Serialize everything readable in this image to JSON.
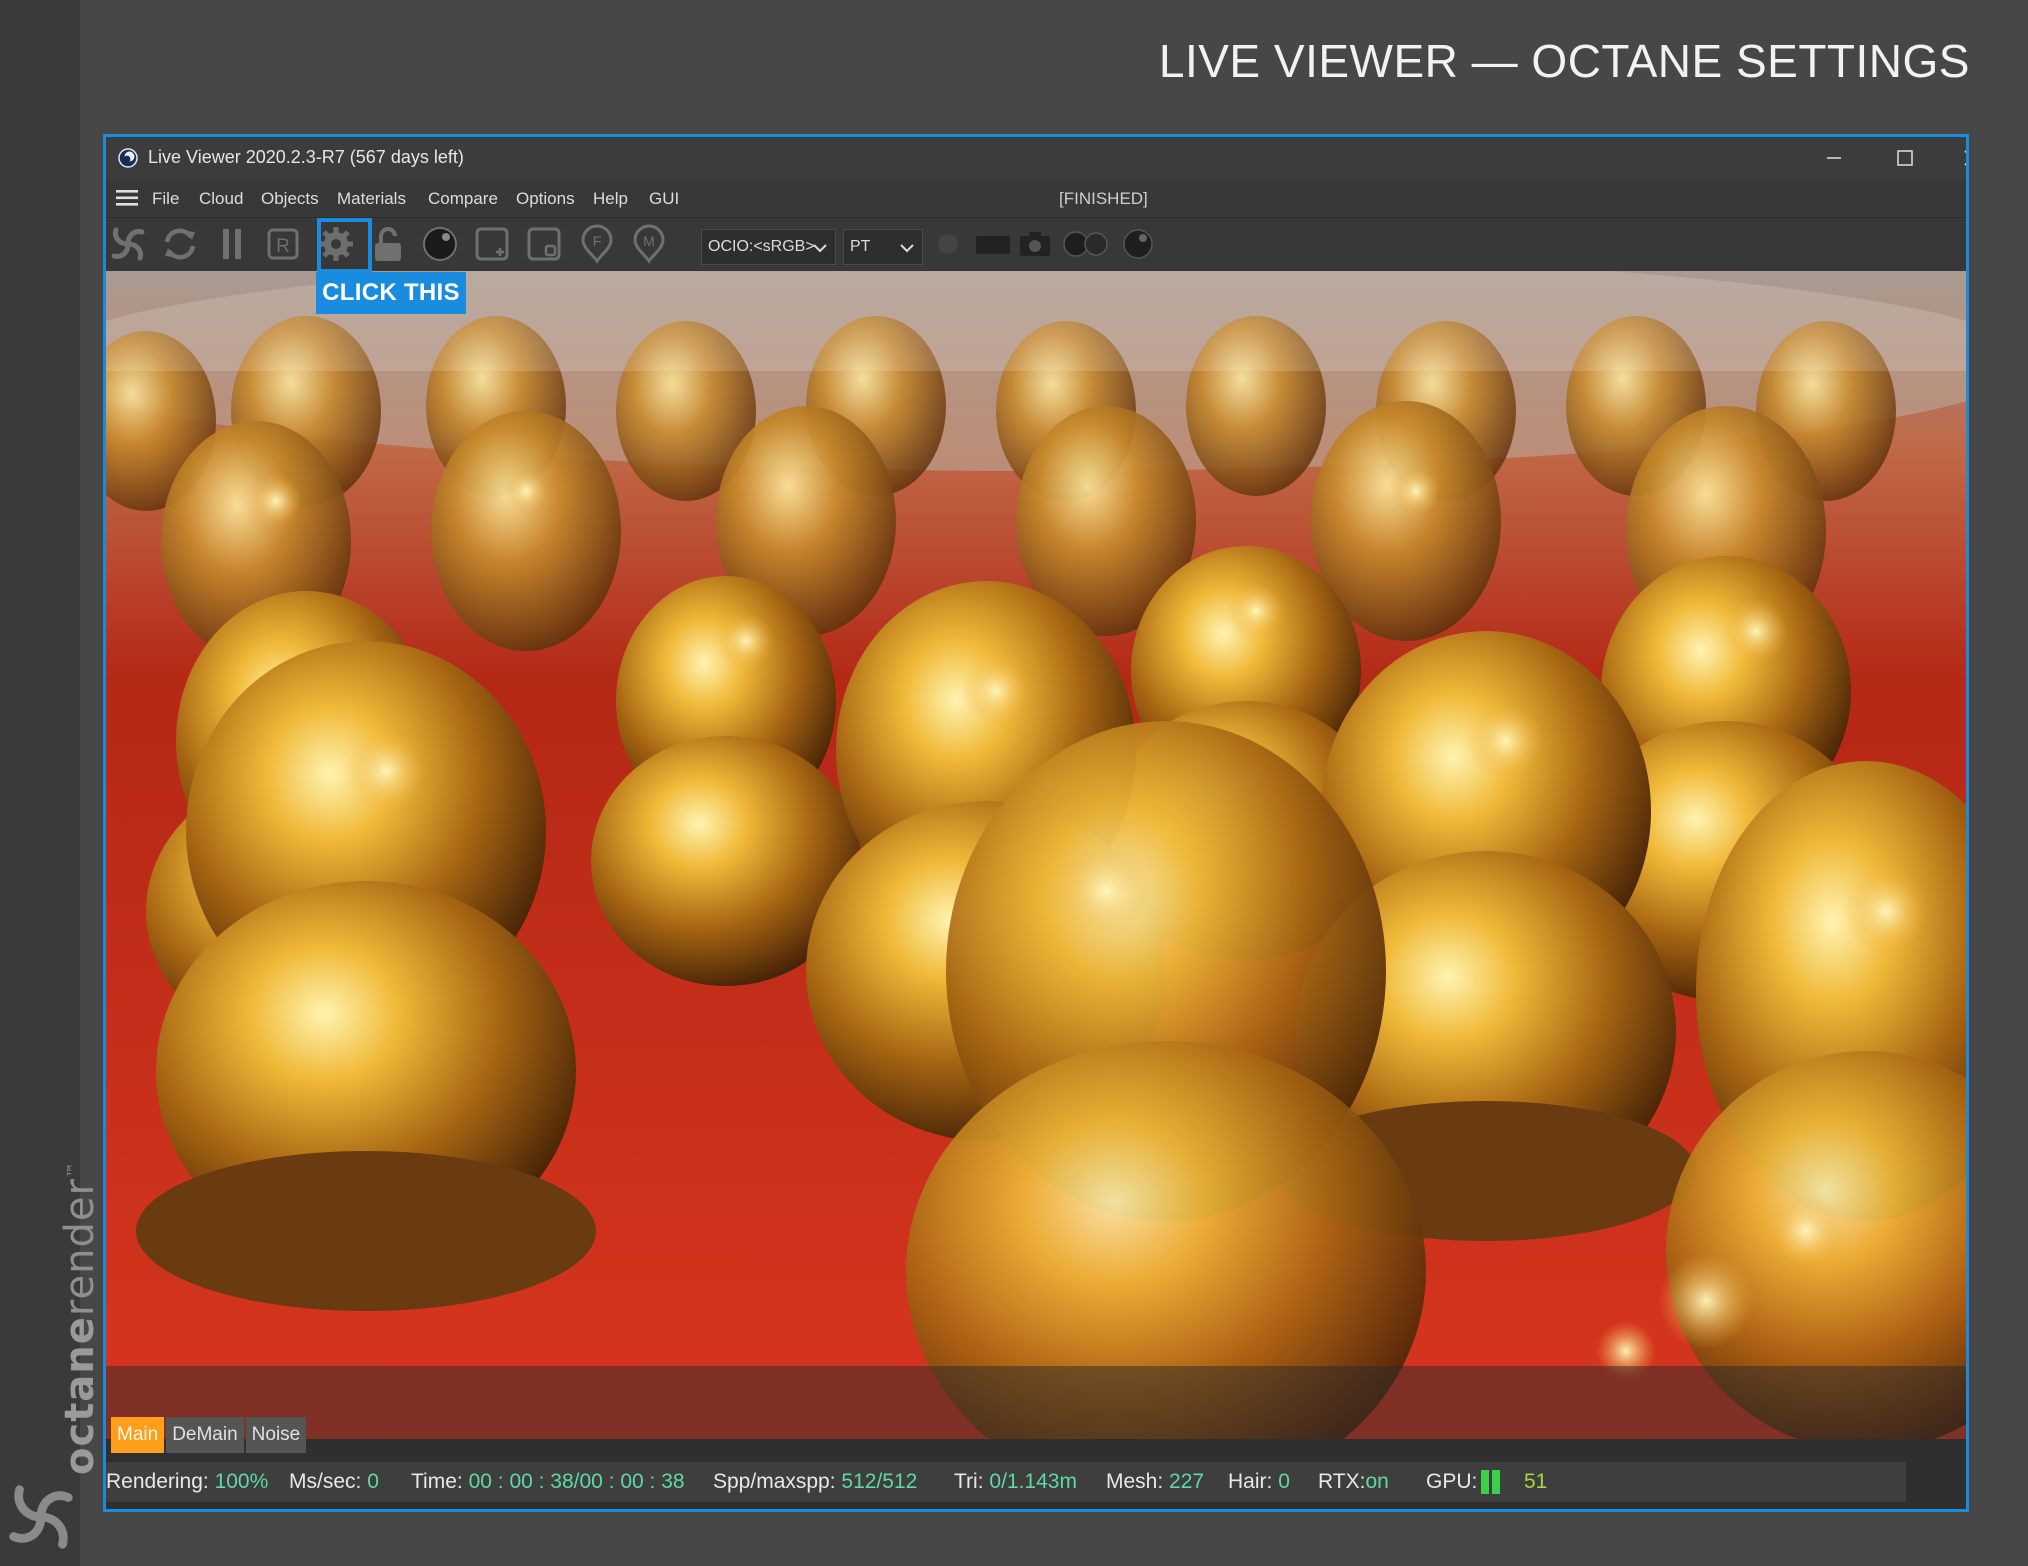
{
  "page": {
    "title": "LIVE VIEWER — OCTANE SETTINGS"
  },
  "brand": {
    "wordmark_bold": "octane",
    "wordmark_light": "render",
    "trademark": "™"
  },
  "window": {
    "title": "Live Viewer 2020.2.3-R7 (567 days left)"
  },
  "menu": {
    "items": [
      "File",
      "Cloud",
      "Objects",
      "Materials",
      "Compare",
      "Options",
      "Help",
      "GUI"
    ],
    "render_status": "[FINISHED]"
  },
  "toolbar": {
    "icons": [
      "octane-send-scene-icon",
      "restart-render-icon",
      "pause-render-icon",
      "render-region-icon",
      "settings-gear-icon",
      "lock-icon",
      "material-preview-icon",
      "add-region-icon",
      "resize-region-icon",
      "focus-picker-icon",
      "material-picker-icon"
    ],
    "color_space_select": "OCIO:<sRGB>",
    "kernel_select": "PT",
    "callout": "CLICK THIS"
  },
  "render_passes": {
    "tabs": [
      "Main",
      "DeMain",
      "Noise"
    ],
    "active": "Main"
  },
  "status": {
    "rendering_label": "Rendering:",
    "rendering_value": "100%",
    "ms_label": "Ms/sec:",
    "ms_value": "0",
    "time_label": "Time:",
    "time_value": "00 : 00 : 38/00 : 00 : 38",
    "spp_label": "Spp/maxspp:",
    "spp_value": "512/512",
    "tri_label": "Tri:",
    "tri_value": "0/1.143m",
    "mesh_label": "Mesh:",
    "mesh_value": "227",
    "hair_label": "Hair:",
    "hair_value": "0",
    "rtx_label": "RTX:",
    "rtx_value": "on",
    "gpu_label": "GPU:",
    "gpu_value": "51"
  },
  "colors": {
    "accent": "#1a8ce0",
    "active_tab": "#ff9e1b",
    "status_value": "#5fd9a4",
    "gpu_bar": "#3bd14a"
  }
}
